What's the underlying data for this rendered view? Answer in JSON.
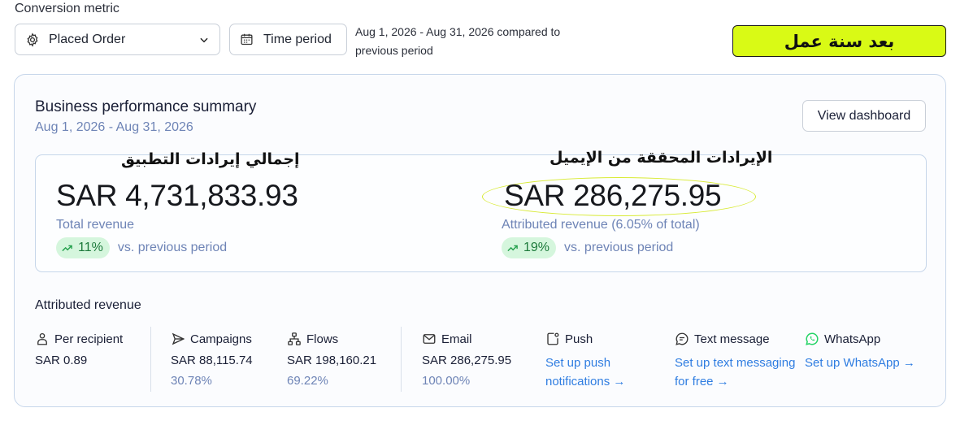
{
  "header": {
    "conversion_label": "Conversion metric",
    "metric_select_value": "Placed Order",
    "time_period_label": "Time period",
    "compare_text": "Aug 1, 2026 - Aug 31, 2026 compared to previous period",
    "arabic_badge": "بعد سنة عمل"
  },
  "summary": {
    "title": "Business performance summary",
    "date_range": "Aug 1, 2026 - Aug 31, 2026",
    "view_dashboard_label": "View dashboard",
    "total": {
      "arabic_heading": "إجمالي إيرادات التطبيق",
      "value": "SAR 4,731,833.93",
      "label": "Total revenue",
      "change": "11%",
      "vs_text": "vs. previous period"
    },
    "attributed": {
      "arabic_heading": "الإيرادات المحققة من الإيميل",
      "value": "SAR 286,275.95",
      "label": "Attributed revenue (6.05% of total)",
      "change": "19%",
      "vs_text": "vs. previous period"
    }
  },
  "attributed_revenue": {
    "title": "Attributed revenue",
    "per_recipient": {
      "label": "Per recipient",
      "value": "SAR 0.89"
    },
    "campaigns": {
      "label": "Campaigns",
      "value": "SAR 88,115.74",
      "pct": "30.78%"
    },
    "flows": {
      "label": "Flows",
      "value": "SAR 198,160.21",
      "pct": "69.22%"
    },
    "email": {
      "label": "Email",
      "value": "SAR 286,275.95",
      "pct": "100.00%"
    },
    "push": {
      "label": "Push",
      "link": "Set up push notifications →"
    },
    "text_message": {
      "label": "Text message",
      "link": "Set up text messaging for free →"
    },
    "whatsapp": {
      "label": "WhatsApp",
      "link": "Set up WhatsApp →"
    }
  },
  "colors": {
    "accent_link": "#2f7de1",
    "badge_bg": "#d9fa15",
    "trend_pill_bg": "#d5f6dd",
    "muted_text": "#6e84b6"
  }
}
